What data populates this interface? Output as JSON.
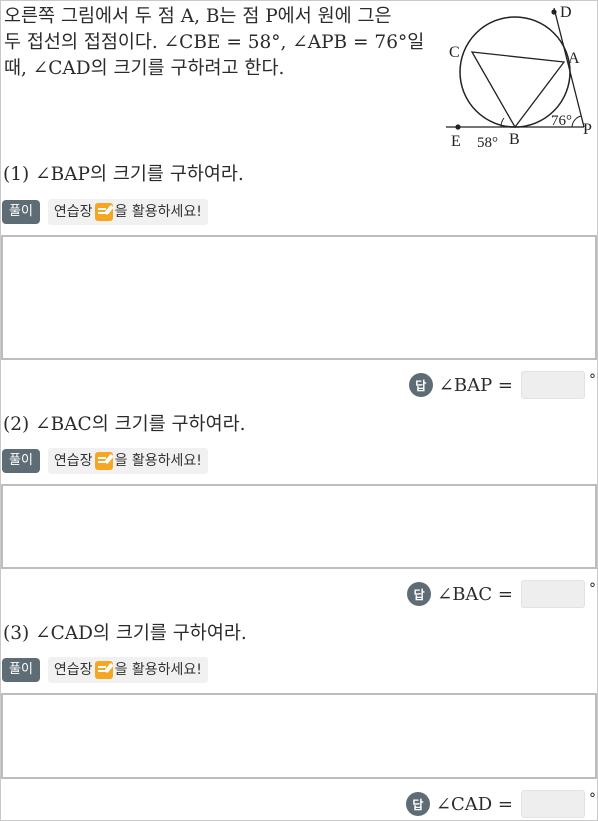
{
  "problem": {
    "line1": "오른쪽 그림에서 두 점 A, B는 점 P에서 원에 그은",
    "line2": "두 접선의 접점이다. ∠CBE = 58°, ∠APB = 76°일",
    "line3": "때, ∠CAD의 크기를 구하려고 한다."
  },
  "diagram": {
    "labels": {
      "D": "D",
      "C": "C",
      "A": "A",
      "E": "E",
      "B": "B",
      "P": "P",
      "angle_b": "58°",
      "angle_p": "76°"
    }
  },
  "questions": [
    {
      "title": "(1) ∠BAP의 크기를 구하여라.",
      "solution_label": "풀이",
      "hint_before": "연습장",
      "hint_after": "을 활용하세요!",
      "answer_badge": "답",
      "answer_label": "∠BAP =",
      "answer_value": "",
      "unit": "°"
    },
    {
      "title": "(2) ∠BAC의 크기를 구하여라.",
      "solution_label": "풀이",
      "hint_before": "연습장",
      "hint_after": "을 활용하세요!",
      "answer_badge": "답",
      "answer_label": "∠BAC =",
      "answer_value": "",
      "unit": "°"
    },
    {
      "title": "(3) ∠CAD의 크기를 구하여라.",
      "solution_label": "풀이",
      "hint_before": "연습장",
      "hint_after": "을 활용하세요!",
      "answer_badge": "답",
      "answer_label": "∠CAD =",
      "answer_value": "",
      "unit": "°"
    }
  ]
}
